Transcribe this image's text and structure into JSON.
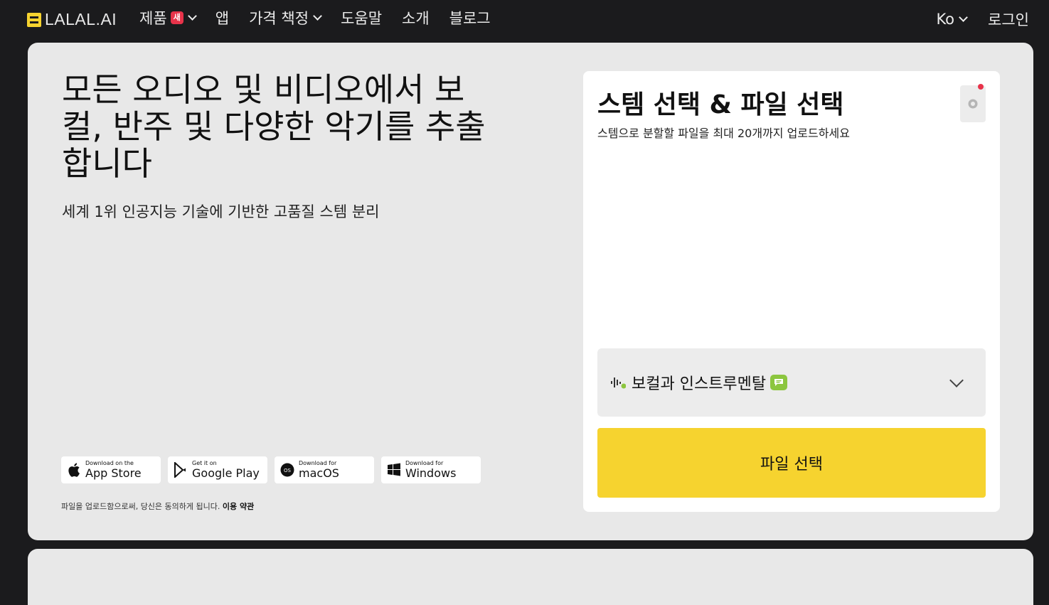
{
  "brand": {
    "name": "LALAL.AI"
  },
  "nav": {
    "items": [
      {
        "label": "제품",
        "badge": "새",
        "has_dropdown": true
      },
      {
        "label": "앱"
      },
      {
        "label": "가격 책정",
        "has_dropdown": true
      },
      {
        "label": "도움말"
      },
      {
        "label": "소개"
      },
      {
        "label": "블로그"
      }
    ],
    "language": "Ko",
    "login": "로그인"
  },
  "hero": {
    "title": "모든 오디오 및 비디오에서 보컬, 반주 및 다양한 악기를 추출합니다",
    "subtitle": "세계 1위 인공지능 기술에 기반한 고품질 스템 분리"
  },
  "stores": [
    {
      "small": "Download on the",
      "big": "App Store",
      "icon": "apple-icon"
    },
    {
      "small": "Get it on",
      "big": "Google Play",
      "icon": "google-play-icon"
    },
    {
      "small": "Download for",
      "big": "macOS",
      "icon": "macos-icon"
    },
    {
      "small": "Download for",
      "big": "Windows",
      "icon": "windows-icon"
    }
  ],
  "terms": {
    "text": "파일을 업로드함으로써, 당신은 동의하게 됩니다.",
    "link": "이용 약관"
  },
  "upload": {
    "title": "스템 선택 & 파일 선택",
    "subtitle": "스템으로 분할할 파일을 최대 20개까지 업로드하세요",
    "stem_option": "보컬과 인스트루멘탈",
    "file_button": "파일 선택"
  },
  "colors": {
    "accent": "#f6d32f",
    "badge": "#e8334a",
    "stem_tag": "#8cc63f",
    "background": "#1b1b1d",
    "card": "#e8e8e8"
  }
}
